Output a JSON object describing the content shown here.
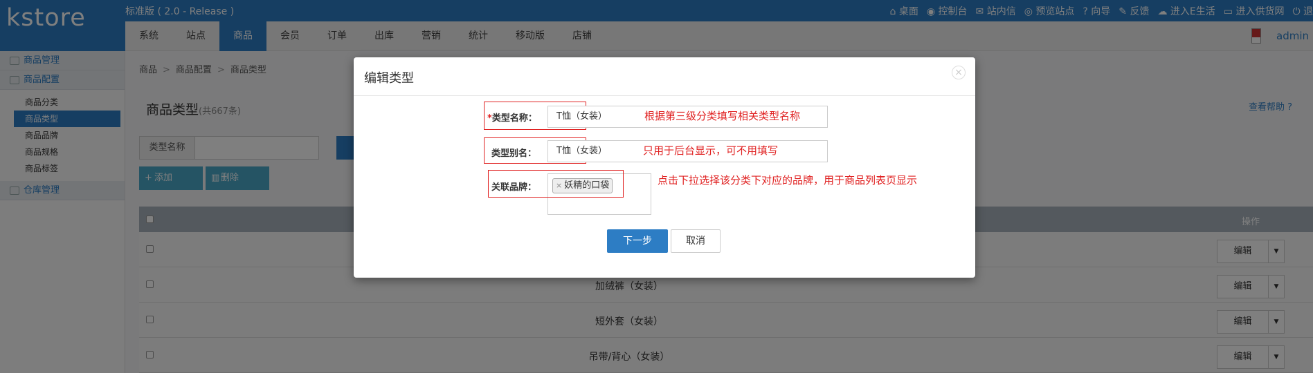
{
  "app": {
    "logo": "kstore",
    "edition": "标准版 ( 2.0 - Release )"
  },
  "toplinks": [
    {
      "icon": "home-icon",
      "label": "桌面"
    },
    {
      "icon": "dashboard-icon",
      "label": "控制台"
    },
    {
      "icon": "mail-icon",
      "label": "站内信"
    },
    {
      "icon": "eye-icon",
      "label": "预览站点"
    },
    {
      "icon": "help-icon",
      "label": "向导"
    },
    {
      "icon": "edit-icon",
      "label": "反馈"
    },
    {
      "icon": "cloud-icon",
      "label": "进入E生活"
    },
    {
      "icon": "drive-icon",
      "label": "进入供货网"
    },
    {
      "icon": "logout-icon",
      "label": "退"
    }
  ],
  "nav": {
    "tabs": [
      "系统",
      "站点",
      "商品",
      "会员",
      "订单",
      "出库",
      "营销",
      "统计",
      "移动版",
      "店铺"
    ],
    "active": "商品",
    "admin_name": "admin"
  },
  "sidebar": {
    "groups": [
      {
        "label": "商品管理",
        "icon": "basket-icon"
      },
      {
        "label": "商品配置",
        "icon": "grid-icon"
      }
    ],
    "items": [
      "商品分类",
      "商品类型",
      "商品品牌",
      "商品规格",
      "商品标签"
    ],
    "active_item": "商品类型",
    "bottom_group": {
      "label": "仓库管理",
      "icon": "warehouse-icon"
    }
  },
  "breadcrumb": [
    "商品",
    "商品配置",
    "商品类型"
  ],
  "page": {
    "title": "商品类型",
    "count": "(共667条)",
    "help": "查看帮助"
  },
  "filter": {
    "label": "类型名称",
    "value": ""
  },
  "buttons": {
    "add": "添加",
    "delete": "删除"
  },
  "table": {
    "op_header": "操作",
    "rows": [
      {
        "name": ""
      },
      {
        "name": "加绒裤（女装）"
      },
      {
        "name": "短外套（女装）"
      },
      {
        "name": "吊带/背心（女装）"
      }
    ],
    "edit_label": "编辑"
  },
  "modal": {
    "title": "编辑类型",
    "close": "×",
    "type_name_label": "类型名称：",
    "type_name_value": "T恤（女装）",
    "alias_label": "类型别名：",
    "alias_value": "T恤（女装）",
    "brand_label": "关联品牌：",
    "brand_tag": "妖精的口袋",
    "annot_name": "根据第三级分类填写相关类型名称",
    "annot_alias": "只用于后台显示，可不用填写",
    "annot_brand": "点击下拉选择该分类下对应的品牌，用于商品列表页显示",
    "next": "下一步",
    "cancel": "取消",
    "required_mark": "*"
  },
  "colors": {
    "primary": "#2d7dc4",
    "annotation": "#e02020",
    "header": "#a9b3bc"
  }
}
